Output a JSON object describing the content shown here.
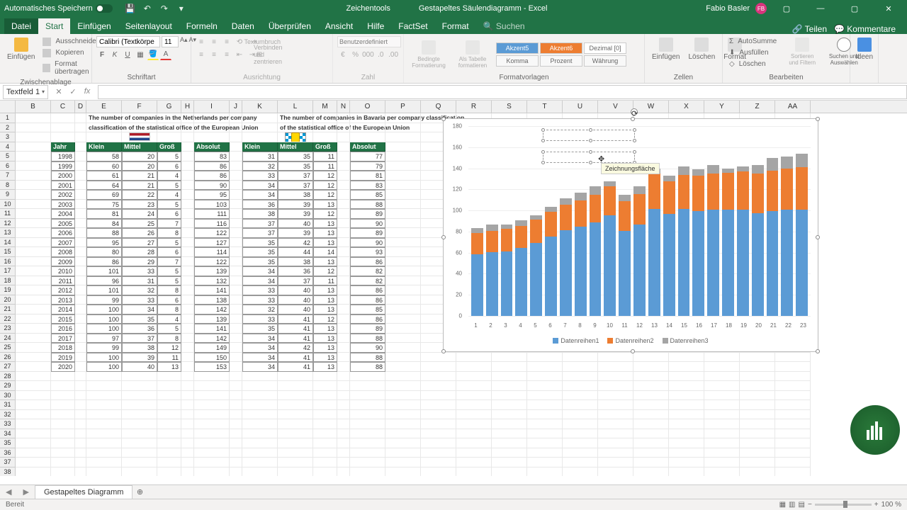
{
  "titlebar": {
    "autosave": "Automatisches Speichern",
    "tools_context": "Zeichentools",
    "doc_title": "Gestapeltes Säulendiagramm - Excel",
    "user": "Fabio Basler",
    "user_initials": "FB"
  },
  "tabs": {
    "file": "Datei",
    "home": "Start",
    "insert": "Einfügen",
    "layout": "Seitenlayout",
    "formulas": "Formeln",
    "data": "Daten",
    "review": "Überprüfen",
    "view": "Ansicht",
    "help": "Hilfe",
    "factset": "FactSet",
    "format": "Format",
    "search": "Suchen",
    "share": "Teilen",
    "comments": "Kommentare"
  },
  "ribbon": {
    "paste": "Einfügen",
    "cut": "Ausschneiden",
    "copy": "Kopieren",
    "painter": "Format übertragen",
    "clipboard_label": "Zwischenablage",
    "font_name": "Calibri (Textkörpe",
    "font_size": "11",
    "font_label": "Schriftart",
    "wrap": "Textumbruch",
    "merge": "Verbinden und zentrieren",
    "align_label": "Ausrichtung",
    "num_format": "Benutzerdefiniert",
    "num_label": "Zahl",
    "cond_fmt": "Bedingte Formatierung",
    "as_table": "Als Tabelle formatieren",
    "style_a5": "Akzent5",
    "style_a6": "Akzent6",
    "style_dez": "Dezimal [0]",
    "style_komma": "Komma",
    "style_prozent": "Prozent",
    "style_wahr": "Währung",
    "styles_label": "Formatvorlagen",
    "ins": "Einfügen",
    "del": "Löschen",
    "fmt": "Format",
    "cells_label": "Zellen",
    "autosum": "AutoSumme",
    "fill": "Ausfüllen",
    "clear": "Löschen",
    "sort": "Sortieren und Filtern",
    "find": "Suchen und Auswählen",
    "edit_label": "Bearbeiten",
    "ideas": "Ideen"
  },
  "namebox": "Textfeld 1",
  "columns": [
    "B",
    "C",
    "D",
    "E",
    "F",
    "G",
    "H",
    "I",
    "J",
    "K",
    "L",
    "M",
    "N",
    "O",
    "P",
    "Q",
    "R",
    "S",
    "T",
    "U",
    "V",
    "W",
    "X",
    "Y",
    "Z",
    "AA"
  ],
  "table_titles": {
    "nl1": "The number of companies in the Netherlands per company",
    "nl2": "classification of the statistical office of the European Union",
    "bav1": "The number of companies in Bavaria per company classification",
    "bav2": "of the statistical office of the European Union"
  },
  "headers": {
    "jahr": "Jahr",
    "klein": "Klein",
    "mittel": "Mittel",
    "gross": "Groß",
    "absolut": "Absolut"
  },
  "years": [
    1998,
    1999,
    2000,
    2001,
    2002,
    2003,
    2004,
    2005,
    2006,
    2007,
    2008,
    2009,
    2010,
    2011,
    2012,
    2013,
    2014,
    2015,
    2016,
    2017,
    2018,
    2019,
    2020
  ],
  "nl": {
    "klein": [
      58,
      60,
      61,
      64,
      69,
      75,
      81,
      84,
      88,
      95,
      80,
      86,
      101,
      96,
      101,
      99,
      100,
      100,
      100,
      97,
      99,
      100,
      100
    ],
    "mittel": [
      20,
      20,
      21,
      21,
      22,
      23,
      24,
      25,
      26,
      27,
      28,
      29,
      33,
      31,
      32,
      33,
      34,
      35,
      36,
      37,
      38,
      39,
      40
    ],
    "gross": [
      5,
      6,
      4,
      5,
      4,
      5,
      6,
      7,
      8,
      5,
      6,
      7,
      5,
      5,
      8,
      6,
      8,
      4,
      5,
      8,
      12,
      11,
      13
    ],
    "absolut": [
      83,
      86,
      86,
      90,
      95,
      103,
      111,
      116,
      122,
      127,
      114,
      122,
      139,
      132,
      141,
      138,
      142,
      139,
      141,
      142,
      149,
      150,
      153
    ]
  },
  "bav": {
    "klein": [
      31,
      32,
      33,
      34,
      34,
      36,
      38,
      37,
      37,
      35,
      35,
      35,
      34,
      34,
      33,
      33,
      32,
      33,
      35,
      34,
      34,
      34,
      34
    ],
    "mittel": [
      35,
      35,
      37,
      37,
      38,
      39,
      39,
      40,
      39,
      42,
      44,
      38,
      36,
      37,
      40,
      40,
      40,
      41,
      41,
      41,
      42,
      41,
      41
    ],
    "gross": [
      11,
      11,
      12,
      12,
      12,
      13,
      12,
      13,
      13,
      13,
      14,
      13,
      12,
      11,
      13,
      13,
      13,
      12,
      13,
      13,
      13,
      13,
      13
    ],
    "absolut": [
      77,
      79,
      81,
      83,
      85,
      88,
      89,
      90,
      89,
      90,
      93,
      86,
      82,
      82,
      86,
      86,
      85,
      86,
      89,
      88,
      90,
      88,
      88
    ]
  },
  "chart_data": {
    "type": "bar",
    "stacked": true,
    "categories": [
      1,
      2,
      3,
      4,
      5,
      6,
      7,
      8,
      9,
      10,
      11,
      12,
      13,
      14,
      15,
      16,
      17,
      18,
      19,
      20,
      21,
      22,
      23
    ],
    "series": [
      {
        "name": "Datenreihen1",
        "color": "#5b9bd5",
        "values": [
          58,
          60,
          61,
          64,
          69,
          75,
          81,
          84,
          88,
          95,
          80,
          86,
          101,
          96,
          101,
          99,
          100,
          100,
          100,
          97,
          99,
          100,
          100
        ]
      },
      {
        "name": "Datenreihen2",
        "color": "#ed7d31",
        "values": [
          20,
          20,
          21,
          21,
          22,
          23,
          24,
          25,
          26,
          27,
          28,
          29,
          33,
          31,
          32,
          33,
          34,
          35,
          36,
          37,
          38,
          39,
          40
        ]
      },
      {
        "name": "Datenreihen3",
        "color": "#a5a5a5",
        "values": [
          5,
          6,
          4,
          5,
          4,
          5,
          6,
          7,
          8,
          5,
          6,
          7,
          5,
          5,
          8,
          6,
          8,
          4,
          5,
          8,
          12,
          11,
          13
        ]
      }
    ],
    "ylim": [
      0,
      180
    ],
    "yticks": [
      0,
      20,
      40,
      60,
      80,
      100,
      120,
      140,
      160,
      180
    ]
  },
  "chart_tooltip": "Zeichnungsfläche",
  "sheet_tab": "Gestapeltes Diagramm",
  "status": {
    "ready": "Bereit",
    "zoom": "100 %"
  }
}
